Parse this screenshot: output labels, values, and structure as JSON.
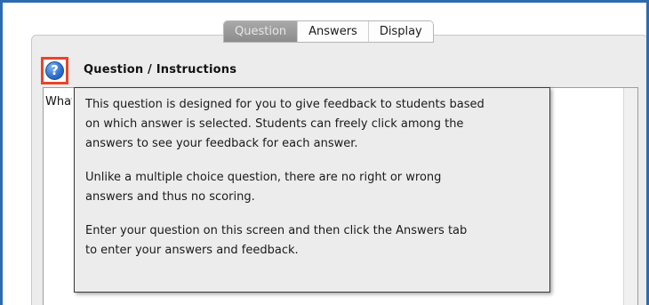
{
  "tabs": [
    {
      "label": "Question",
      "active": true
    },
    {
      "label": "Answers",
      "active": false
    },
    {
      "label": "Display",
      "active": false
    }
  ],
  "section": {
    "heading": "Question / Instructions",
    "help_icon": "question-mark-icon"
  },
  "editor": {
    "visible_text": "What"
  },
  "tooltip": {
    "paragraphs": [
      "This question is designed for you to give feedback to students based\non which answer is selected. Students can freely click among the\nanswers to see your feedback for each answer.",
      "Unlike a multiple choice question, there are no right or wrong\nanswers and thus no scoring.",
      "Enter your question on this screen and then click the Answers tab\nto enter your answers and feedback."
    ]
  },
  "colors": {
    "frame_border": "#2b6cb0",
    "help_highlight": "#e8442c",
    "help_icon": "#2a6dc9",
    "active_tab": "#8c8c8c"
  }
}
